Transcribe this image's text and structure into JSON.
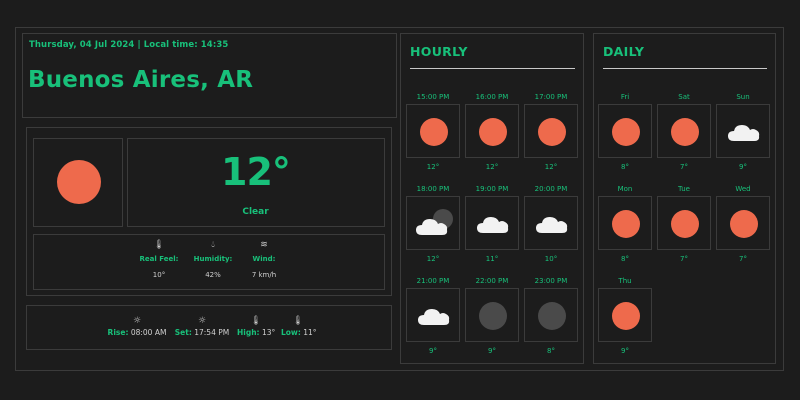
{
  "header": {
    "date_line": "Thursday, 04 Jul 2024 | Local time: 14:35",
    "city": "Buenos Aires, AR"
  },
  "current": {
    "icon": "sun-icon",
    "temp": "12°",
    "condition": "Clear",
    "real_feel": {
      "label": "Real Feel:",
      "value": "10°",
      "icon": "thermometer-icon"
    },
    "humidity": {
      "label": "Humidity:",
      "value": "42%",
      "icon": "droplet-icon"
    },
    "wind": {
      "label": "Wind:",
      "value": "7 km/h",
      "icon": "wind-icon"
    }
  },
  "sun_info": {
    "rise": {
      "label": "Rise:",
      "value": "08:00 AM",
      "icon": "sunrise-icon"
    },
    "set": {
      "label": "Set:",
      "value": "17:54 PM",
      "icon": "sunset-icon"
    },
    "high": {
      "label": "High:",
      "value": "13°",
      "icon": "thermometer-high-icon"
    },
    "low": {
      "label": "Low:",
      "value": "11°",
      "icon": "thermometer-low-icon"
    }
  },
  "hourly": {
    "title": "HOURLY",
    "items": [
      {
        "time": "15:00 PM",
        "temp": "12°",
        "icon": "sun"
      },
      {
        "time": "16:00 PM",
        "temp": "12°",
        "icon": "sun"
      },
      {
        "time": "17:00 PM",
        "temp": "12°",
        "icon": "sun"
      },
      {
        "time": "18:00 PM",
        "temp": "12°",
        "icon": "cloud-moon"
      },
      {
        "time": "19:00 PM",
        "temp": "11°",
        "icon": "cloud"
      },
      {
        "time": "20:00 PM",
        "temp": "10°",
        "icon": "cloud"
      },
      {
        "time": "21:00 PM",
        "temp": "9°",
        "icon": "cloud"
      },
      {
        "time": "22:00 PM",
        "temp": "9°",
        "icon": "moon"
      },
      {
        "time": "23:00 PM",
        "temp": "8°",
        "icon": "moon"
      }
    ]
  },
  "daily": {
    "title": "DAILY",
    "items": [
      {
        "day": "Fri",
        "temp": "8°",
        "icon": "sun"
      },
      {
        "day": "Sat",
        "temp": "7°",
        "icon": "sun"
      },
      {
        "day": "Sun",
        "temp": "9°",
        "icon": "cloud"
      },
      {
        "day": "Mon",
        "temp": "8°",
        "icon": "sun"
      },
      {
        "day": "Tue",
        "temp": "7°",
        "icon": "sun"
      },
      {
        "day": "Wed",
        "temp": "7°",
        "icon": "sun"
      },
      {
        "day": "Thu",
        "temp": "9°",
        "icon": "sun"
      }
    ]
  },
  "colors": {
    "accent": "#18c07a",
    "sun": "#ee6a4c",
    "background": "#1c1c1c",
    "border": "#3b3b3b"
  }
}
